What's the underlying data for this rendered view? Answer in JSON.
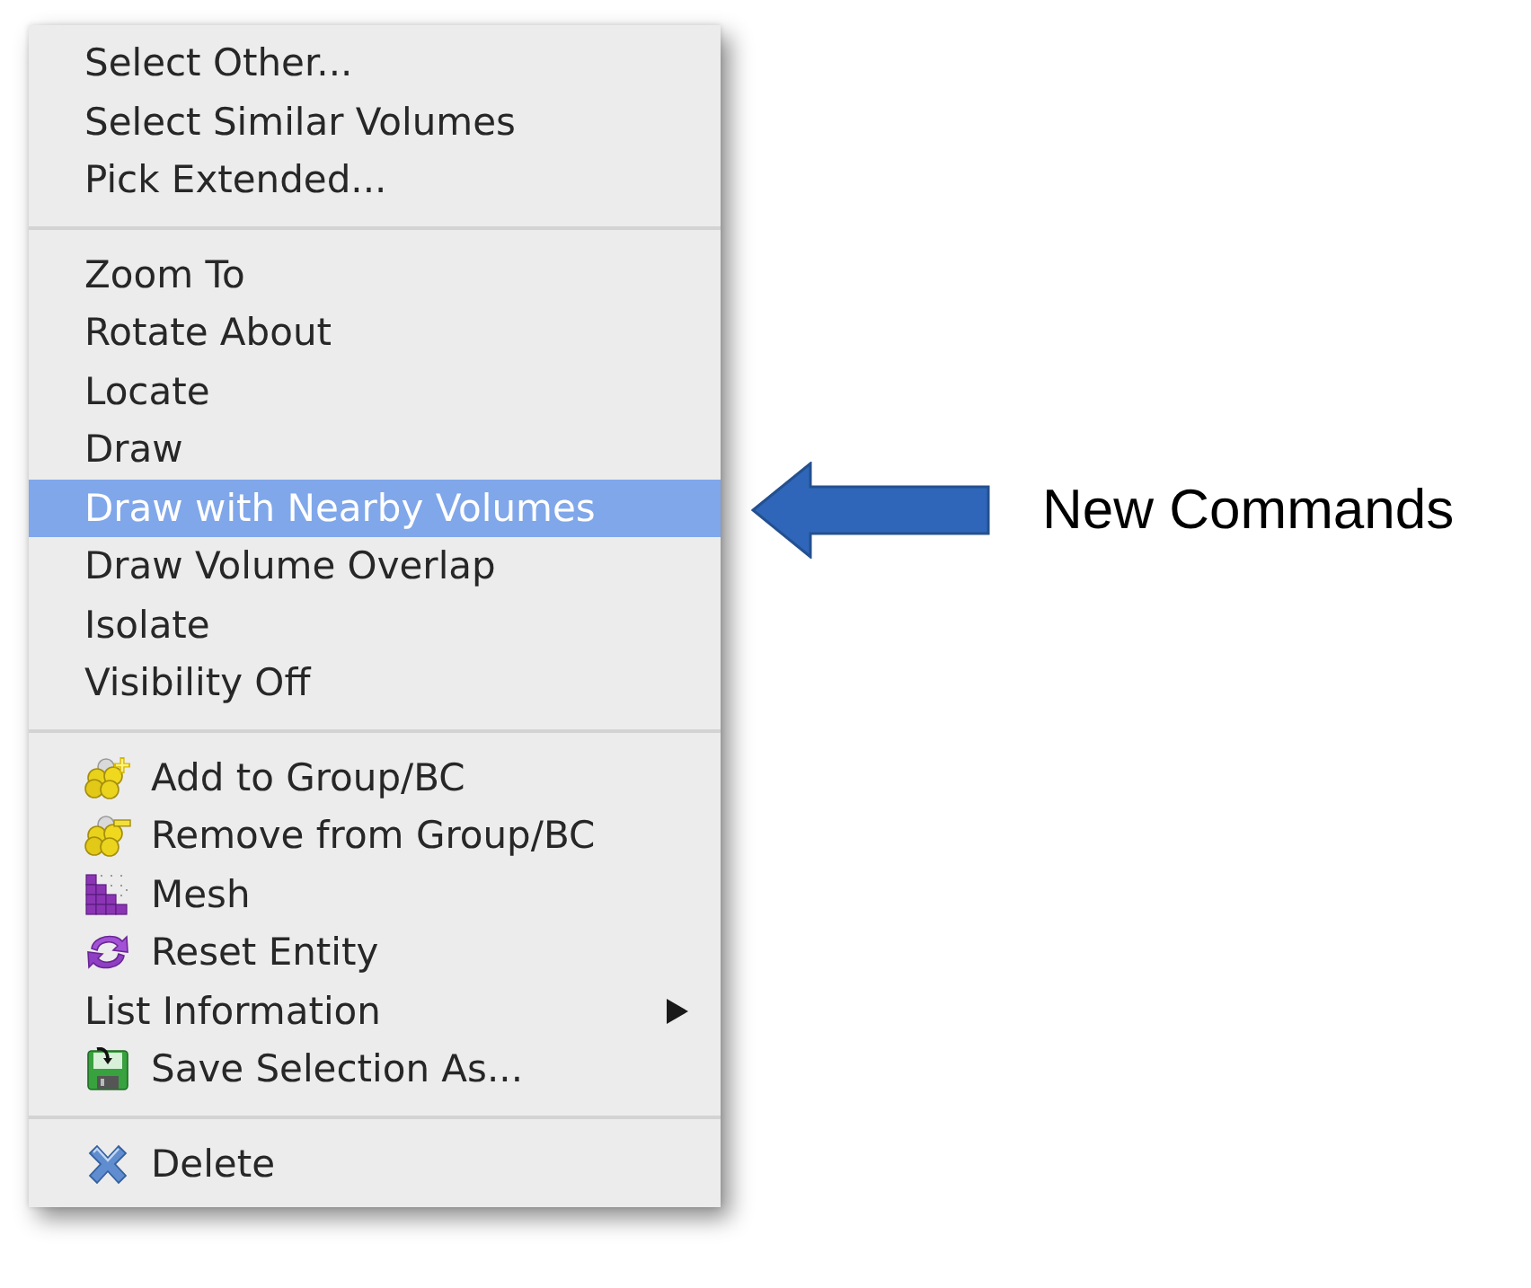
{
  "context_menu": {
    "sections": [
      {
        "items": [
          {
            "label": "Select Other...",
            "kind": "plain",
            "selected": false
          },
          {
            "label": "Select Similar Volumes",
            "kind": "plain",
            "selected": false
          },
          {
            "label": "Pick Extended...",
            "kind": "plain",
            "selected": false
          }
        ]
      },
      {
        "items": [
          {
            "label": "Zoom To",
            "kind": "plain",
            "selected": false
          },
          {
            "label": "Rotate About",
            "kind": "plain",
            "selected": false
          },
          {
            "label": "Locate",
            "kind": "plain",
            "selected": false
          },
          {
            "label": "Draw",
            "kind": "plain",
            "selected": false
          },
          {
            "label": "Draw with Nearby Volumes",
            "kind": "plain",
            "selected": true
          },
          {
            "label": "Draw Volume Overlap",
            "kind": "plain",
            "selected": false
          },
          {
            "label": "Isolate",
            "kind": "plain",
            "selected": false
          },
          {
            "label": "Visibility Off",
            "kind": "plain",
            "selected": false
          }
        ]
      },
      {
        "items": [
          {
            "label": "Add to Group/BC",
            "kind": "add",
            "selected": false
          },
          {
            "label": "Remove from Group/BC",
            "kind": "remove",
            "selected": false
          },
          {
            "label": "Mesh",
            "kind": "mesh",
            "selected": false
          },
          {
            "label": "Reset Entity",
            "kind": "reset",
            "selected": false
          },
          {
            "label": "List Information",
            "kind": "submenu",
            "selected": false
          },
          {
            "label": "Save Selection As...",
            "kind": "save",
            "selected": false
          }
        ]
      },
      {
        "items": [
          {
            "label": "Delete",
            "kind": "delete",
            "selected": false
          }
        ]
      }
    ]
  },
  "callout": {
    "label": "New Commands"
  }
}
